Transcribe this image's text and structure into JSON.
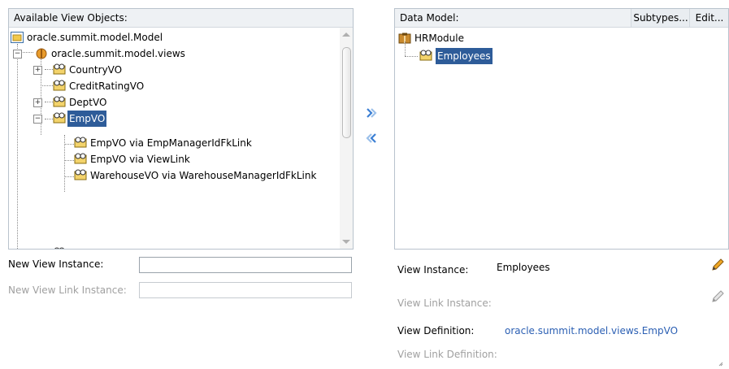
{
  "left": {
    "title": "Available View Objects:",
    "root": "oracle.summit.model.Model",
    "package": "oracle.summit.model.views",
    "items": [
      "CountryVO",
      "CreditRatingVO",
      "DeptVO",
      "EmpVO"
    ],
    "children": [
      "EmpVO via EmpManagerIdFkLink",
      "EmpVO via ViewLink",
      "WarehouseVO via WarehouseManagerIdFkLink"
    ],
    "new_view_instance_label": "New View Instance:",
    "new_view_instance_value": "",
    "new_view_link_instance_label": "New View Link Instance:",
    "new_view_link_instance_value": ""
  },
  "right": {
    "title": "Data Model:",
    "subtypes_label": "Subtypes...",
    "edit_label": "Edit...",
    "module": "HRModule",
    "instance": "Employees",
    "view_instance_label": "View Instance:",
    "view_instance_value": "Employees",
    "view_link_instance_label": "View Link Instance:",
    "view_definition_label": "View Definition:",
    "view_definition_value": "oracle.summit.model.views.EmpVO",
    "view_link_definition_label": "View Link Definition:"
  },
  "icons": {
    "add": "chevron-right-double-icon",
    "remove": "chevron-left-double-icon",
    "edit": "pencil-icon"
  },
  "colors": {
    "selection": "#2e5c99",
    "link": "#2b5fb3",
    "shuttle": "#3b7fd4"
  }
}
